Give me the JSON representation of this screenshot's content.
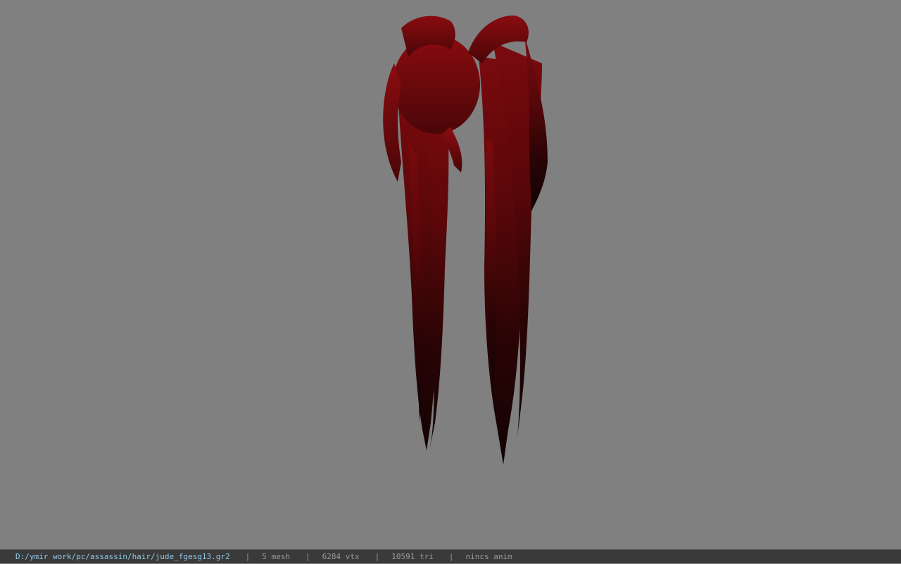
{
  "viewport": {
    "background": "#808080",
    "model_color_top": "#7a0a0e",
    "model_color_bottom": "#140304"
  },
  "status": {
    "file_path": "D:/ymir work/pc/assassin/hair/jude_fgesg13.gr2",
    "separator": "|",
    "mesh_count": "5 mesh",
    "vertex_count": "6284 vtx",
    "triangle_count": "10591 tri",
    "anim": "nincs anim"
  }
}
